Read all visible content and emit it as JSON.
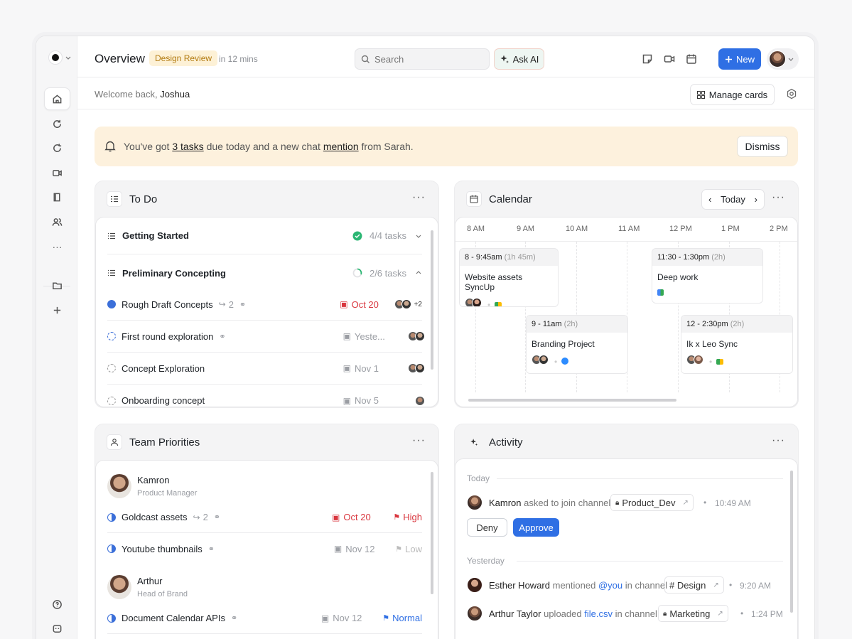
{
  "topbar": {
    "title": "Overview",
    "badge": "Design Review",
    "when": "in 12 mins",
    "search_placeholder": "Search",
    "ask_ai": "Ask AI",
    "new_label": "New"
  },
  "subbar": {
    "welcome": "Welcome back,",
    "user": "Joshua",
    "manage_cards": "Manage cards"
  },
  "alert": {
    "prefix": "You've got",
    "tasks_link": "3 tasks",
    "middle": "due today and a new chat",
    "mention_link": "mention",
    "suffix": "from Sarah.",
    "dismiss": "Dismiss"
  },
  "todo": {
    "title": "To Do",
    "groups": [
      {
        "name": "Getting Started",
        "count": "4/4 tasks"
      },
      {
        "name": "Preliminary Concepting",
        "count": "2/6 tasks"
      }
    ],
    "tasks": [
      {
        "name": "Rough Draft Concepts",
        "subtasks": "2",
        "date": "Oct 20",
        "extra": "+2"
      },
      {
        "name": "First round exploration",
        "date": "Yeste..."
      },
      {
        "name": "Concept Exploration",
        "date": "Nov 1"
      },
      {
        "name": "Onboarding concept",
        "date": "Nov 5"
      }
    ]
  },
  "calendar": {
    "title": "Calendar",
    "today": "Today",
    "hours": [
      "8 AM",
      "9 AM",
      "10 AM",
      "11 AM",
      "12 PM",
      "1 PM",
      "2 PM"
    ],
    "events": [
      {
        "time": "8 - 9:45am",
        "dur": "(1h 45m)",
        "title": "Website assets SyncUp"
      },
      {
        "time": "11:30 - 1:30pm",
        "dur": "(2h)",
        "title": "Deep work"
      },
      {
        "time": "9 - 11am",
        "dur": "(2h)",
        "title": "Branding Project"
      },
      {
        "time": "12 - 2:30pm",
        "dur": "(2h)",
        "title": "Ik x Leo Sync"
      }
    ]
  },
  "team": {
    "title": "Team Priorities",
    "people": [
      {
        "name": "Kamron",
        "role": "Product Manager"
      },
      {
        "name": "Arthur",
        "role": "Head of Brand"
      }
    ],
    "tasks": [
      {
        "name": "Goldcast assets",
        "subtasks": "2",
        "date": "Oct 20",
        "priority": "High"
      },
      {
        "name": "Youtube thumbnails",
        "date": "Nov 12",
        "priority": "Low"
      },
      {
        "name": "Document Calendar APIs",
        "date": "Nov 12",
        "priority": "Normal"
      }
    ]
  },
  "activity": {
    "title": "Activity",
    "today_label": "Today",
    "yesterday_label": "Yesterday",
    "items": [
      {
        "name": "Kamron",
        "action": "asked to join channel",
        "channel": "Product_Dev",
        "time": "10:49 AM"
      },
      {
        "name": "Esther Howard",
        "action": "mentioned",
        "target": "@you",
        "action2": "in channel",
        "channel": "# Design",
        "time": "9:20 AM"
      },
      {
        "name": "Arthur Taylor",
        "action": "uploaded",
        "target": "file.csv",
        "action2": "in channel",
        "channel": "Marketing",
        "time": "1:24 PM"
      }
    ],
    "deny": "Deny",
    "approve": "Approve"
  }
}
